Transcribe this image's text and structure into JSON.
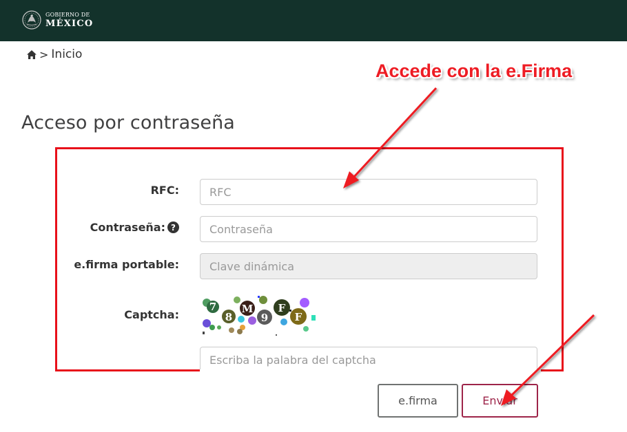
{
  "header": {
    "logo_line1": "GOBIERNO DE",
    "logo_line2": "MÉXICO",
    "emblem_icon": "mexico-eagle-emblem-icon",
    "background_color": "#13322b"
  },
  "breadcrumb": {
    "home_icon": "home-icon",
    "separator": ">",
    "current": "Inicio"
  },
  "page": {
    "title": "Acceso por contraseña"
  },
  "form": {
    "rfc": {
      "label": "RFC:",
      "placeholder": "RFC",
      "value": ""
    },
    "password": {
      "label": "Contraseña:",
      "placeholder": "Contraseña",
      "value": "",
      "help_icon": "question-circle-icon",
      "help_glyph": "?"
    },
    "efirma_portable": {
      "label": "e.firma portable:",
      "placeholder": "Clave dinámica",
      "value": "",
      "disabled": true
    },
    "captcha": {
      "label": "Captcha:",
      "placeholder": "Escriba la palabra del captcha",
      "value": "",
      "characters": [
        "7",
        "8",
        "M",
        "9",
        "F",
        "F"
      ]
    }
  },
  "buttons": {
    "efirma": "e.firma",
    "enviar": "Enviar"
  },
  "annotation": {
    "text": "Accede con la e.Firma",
    "color": "#ee1c24"
  },
  "colors": {
    "accent": "#9d2449",
    "highlight": "#e8101a"
  }
}
